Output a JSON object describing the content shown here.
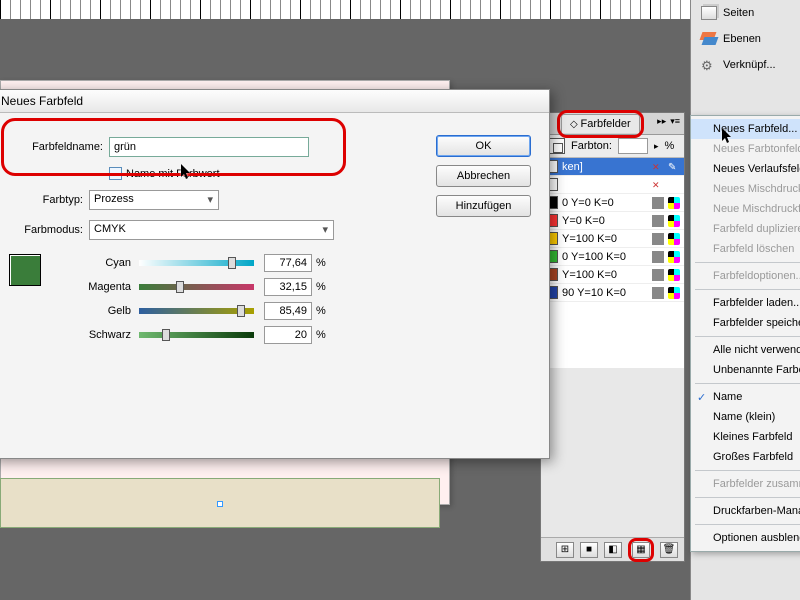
{
  "dialog": {
    "title": "Neues Farbfeld",
    "name_label": "Farbfeldname:",
    "name_value": "grün",
    "name_with_value_label": "Name mit Farbwert",
    "farbtyp_label": "Farbtyp:",
    "farbtyp_value": "Prozess",
    "modus_label": "Farbmodus:",
    "modus_value": "CMYK",
    "buttons": {
      "ok": "OK",
      "cancel": "Abbrechen",
      "add": "Hinzufügen"
    },
    "sliders": [
      {
        "label": "Cyan",
        "value": "77,64",
        "grad": "grad-c",
        "pct": 77.64
      },
      {
        "label": "Magenta",
        "value": "32,15",
        "grad": "grad-m",
        "pct": 32.15
      },
      {
        "label": "Gelb",
        "value": "85,49",
        "grad": "grad-y",
        "pct": 85.49
      },
      {
        "label": "Schwarz",
        "value": "20",
        "grad": "grad-k",
        "pct": 20
      }
    ],
    "pct": "%"
  },
  "panel": {
    "tab": "Farbfelder",
    "farbton_label": "Farbton:",
    "pct": "%",
    "rows": [
      {
        "name": "ken]",
        "color": "#fff",
        "sel": true,
        "x": true,
        "pencil": true
      },
      {
        "name": "",
        "color": "#fff",
        "sel": false,
        "x": true,
        "cmyk": false,
        "gray": true
      },
      {
        "name": "0 Y=0 K=0",
        "color": "#000",
        "cmyk": true
      },
      {
        "name": "Y=0 K=0",
        "color": "#f33",
        "cmyk": true
      },
      {
        "name": "Y=100 K=0",
        "color": "#fc0",
        "cmyk": true
      },
      {
        "name": "0 Y=100 K=0",
        "color": "#3b3",
        "cmyk": true
      },
      {
        "name": "Y=100 K=0",
        "color": "#a42",
        "cmyk": true
      },
      {
        "name": "90 Y=10 K=0",
        "color": "#24a",
        "cmyk": true
      }
    ]
  },
  "dock": {
    "items": [
      {
        "icon": "ic-pages",
        "label": "Seiten"
      },
      {
        "icon": "ic-layers",
        "label": "Ebenen"
      },
      {
        "icon": "ic-links",
        "label": "Verknüpf..."
      }
    ]
  },
  "ctx": {
    "groups": [
      [
        {
          "label": "Neues Farbfeld...",
          "hl": true
        },
        {
          "label": "Neues Farbtonfeld...",
          "disabled": true
        },
        {
          "label": "Neues Verlaufsfeld..."
        },
        {
          "label": "Neues Mischdruckfeld...",
          "disabled": true
        },
        {
          "label": "Neue Mischdruckfarbgruppe...",
          "disabled": true
        },
        {
          "label": "Farbfeld duplizieren",
          "disabled": true
        },
        {
          "label": "Farbfeld löschen",
          "disabled": true
        }
      ],
      [
        {
          "label": "Farbfeldoptionen...",
          "disabled": true
        }
      ],
      [
        {
          "label": "Farbfelder laden..."
        },
        {
          "label": "Farbfelder speichern..."
        }
      ],
      [
        {
          "label": "Alle nicht verwendeten auswählen"
        },
        {
          "label": "Unbenannte Farben hinzufügen"
        }
      ],
      [
        {
          "label": "Name",
          "checked": true
        },
        {
          "label": "Name (klein)"
        },
        {
          "label": "Kleines Farbfeld"
        },
        {
          "label": "Großes Farbfeld"
        }
      ],
      [
        {
          "label": "Farbfelder zusammenführen",
          "disabled": true
        }
      ],
      [
        {
          "label": "Druckfarben-Manager..."
        }
      ],
      [
        {
          "label": "Optionen ausblenden"
        }
      ]
    ]
  }
}
